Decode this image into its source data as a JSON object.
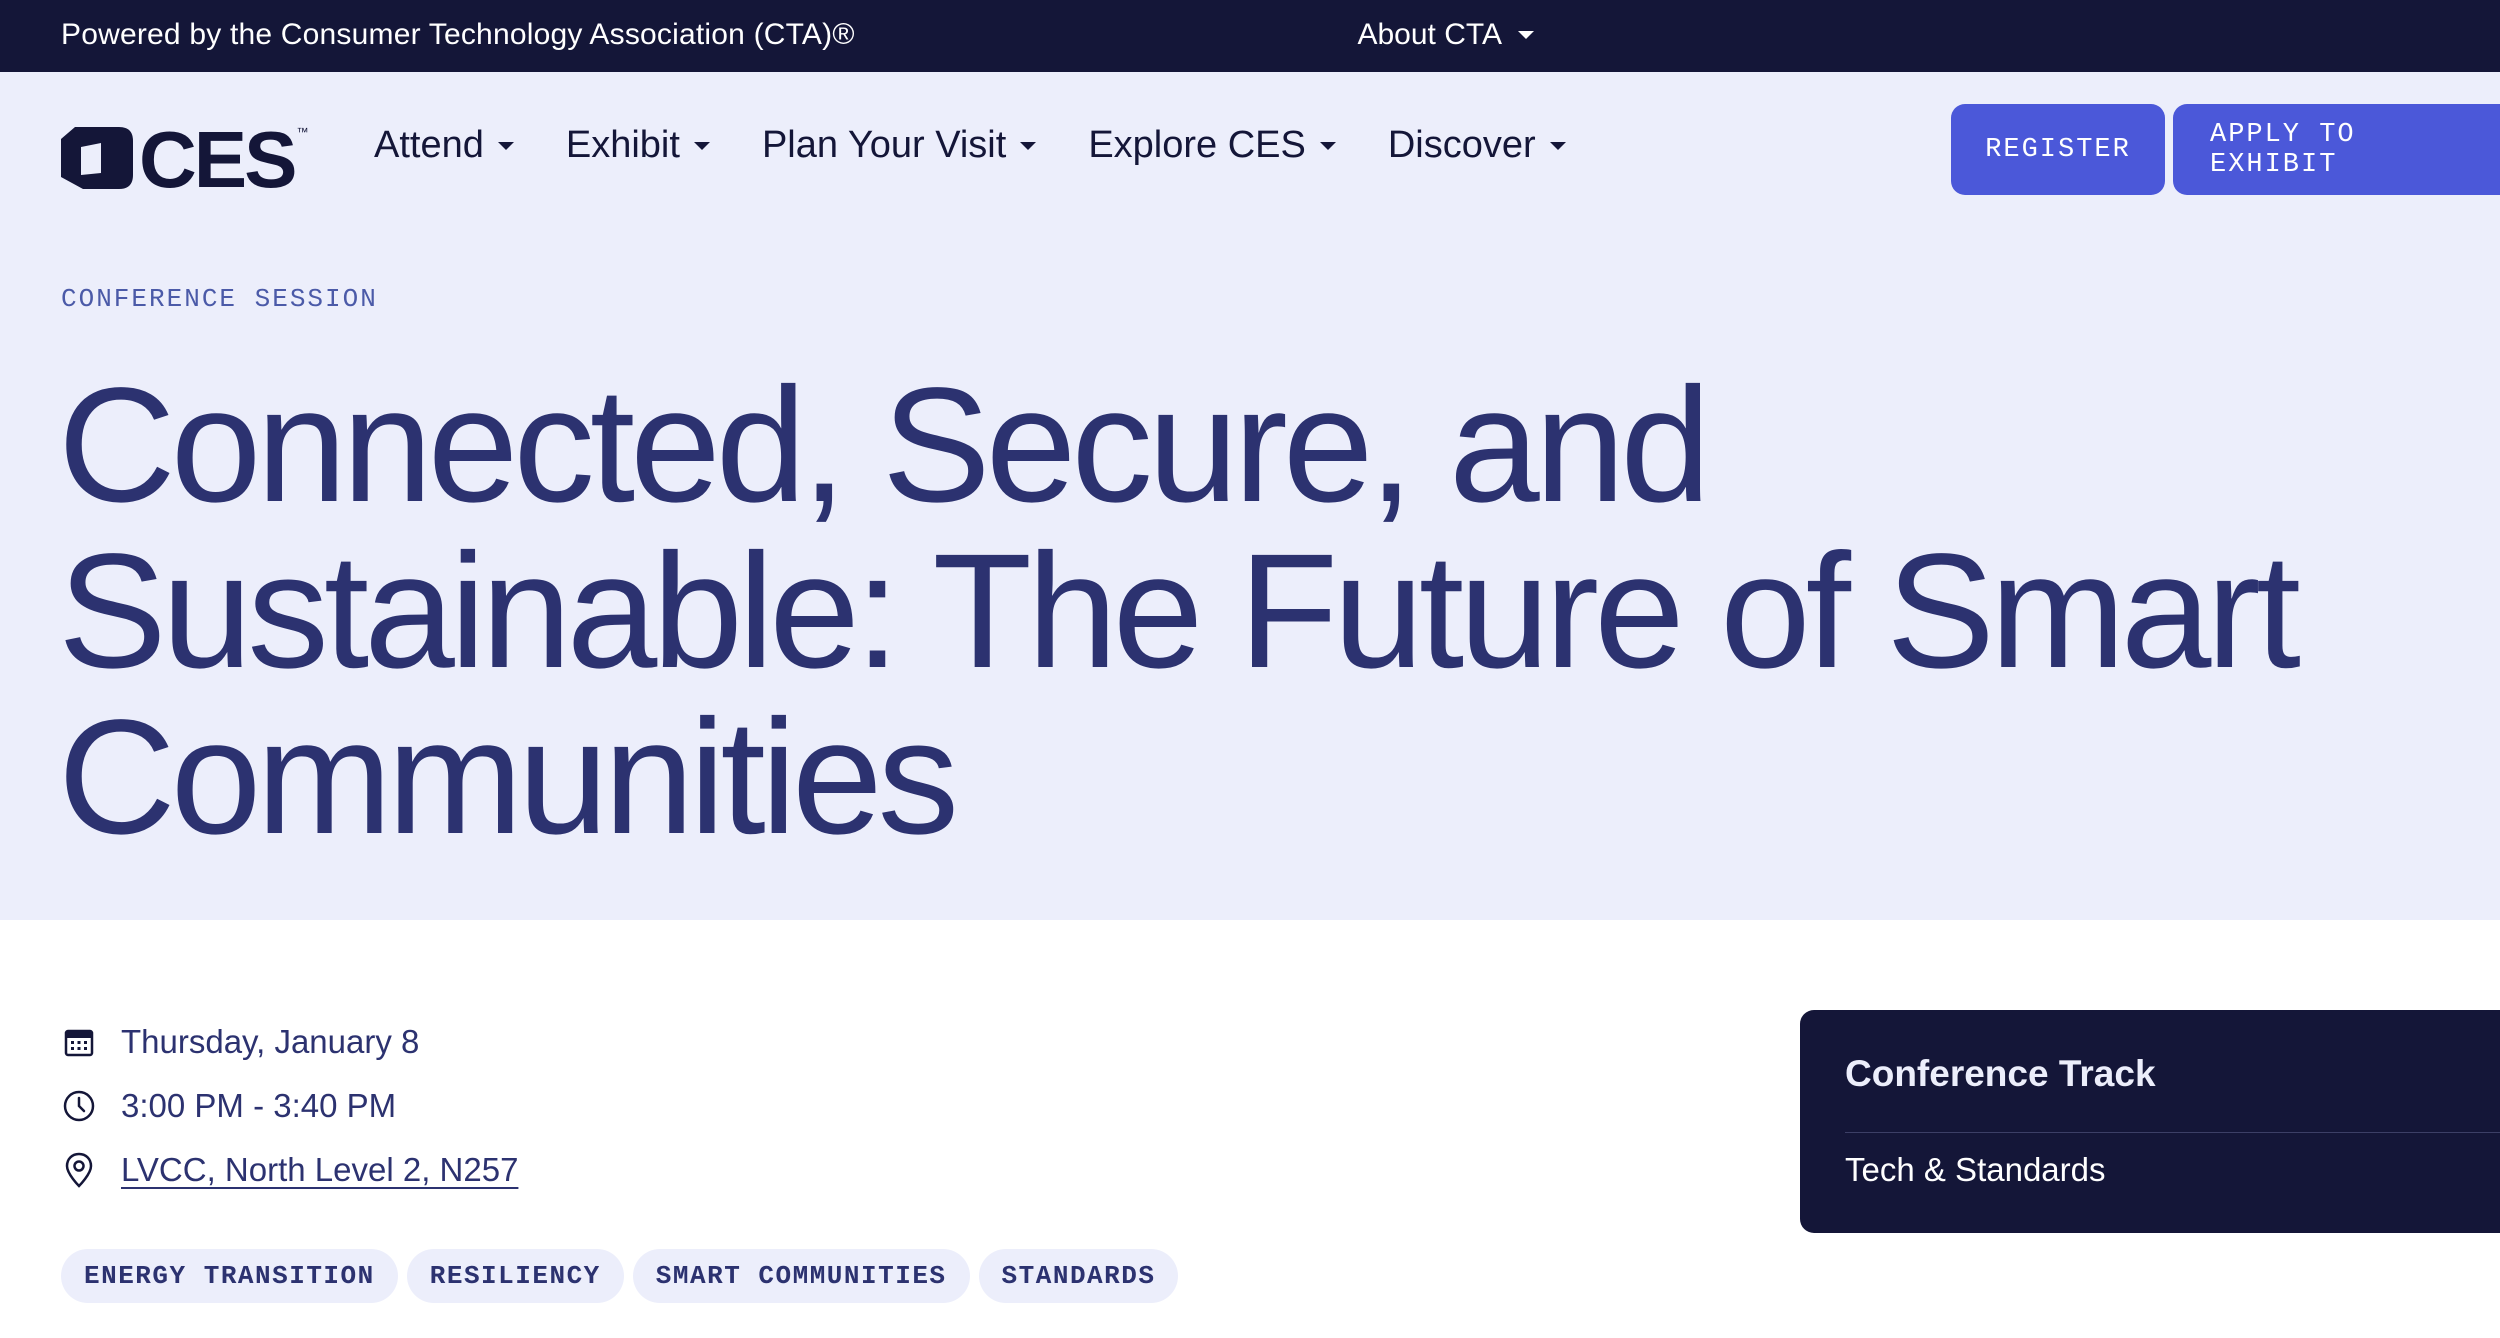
{
  "topbar": {
    "powered_by": "Powered by the Consumer Technology Association (CTA)®",
    "about": "About CTA"
  },
  "nav": {
    "logo_text": "CES",
    "logo_tm": "™",
    "menu": [
      {
        "label": "Attend"
      },
      {
        "label": "Exhibit"
      },
      {
        "label": "Plan Your Visit"
      },
      {
        "label": "Explore CES"
      },
      {
        "label": "Discover"
      }
    ],
    "register_label": "REGISTER",
    "apply_label": "APPLY TO EXHIBIT"
  },
  "session": {
    "eyebrow": "CONFERENCE SESSION",
    "title": "Connected, Secure, and Sustainable: The Future of Smart Communities",
    "date": "Thursday, January 8",
    "time": "3:00 PM - 3:40 PM",
    "location": "LVCC, North Level 2, N257",
    "tags": [
      "ENERGY TRANSITION",
      "RESILIENCY",
      "SMART COMMUNITIES",
      "STANDARDS"
    ]
  },
  "track": {
    "label": "Conference Track",
    "value": "Tech & Standards"
  },
  "icons": {
    "calendar": "calendar-icon",
    "clock": "clock-icon",
    "location": "map-pin-icon",
    "caret": "chevron-down-icon"
  },
  "colors": {
    "topbar_bg": "#141638",
    "hero_bg": "#eceefb",
    "accent": "#4b58d9",
    "title": "#2c3270"
  }
}
